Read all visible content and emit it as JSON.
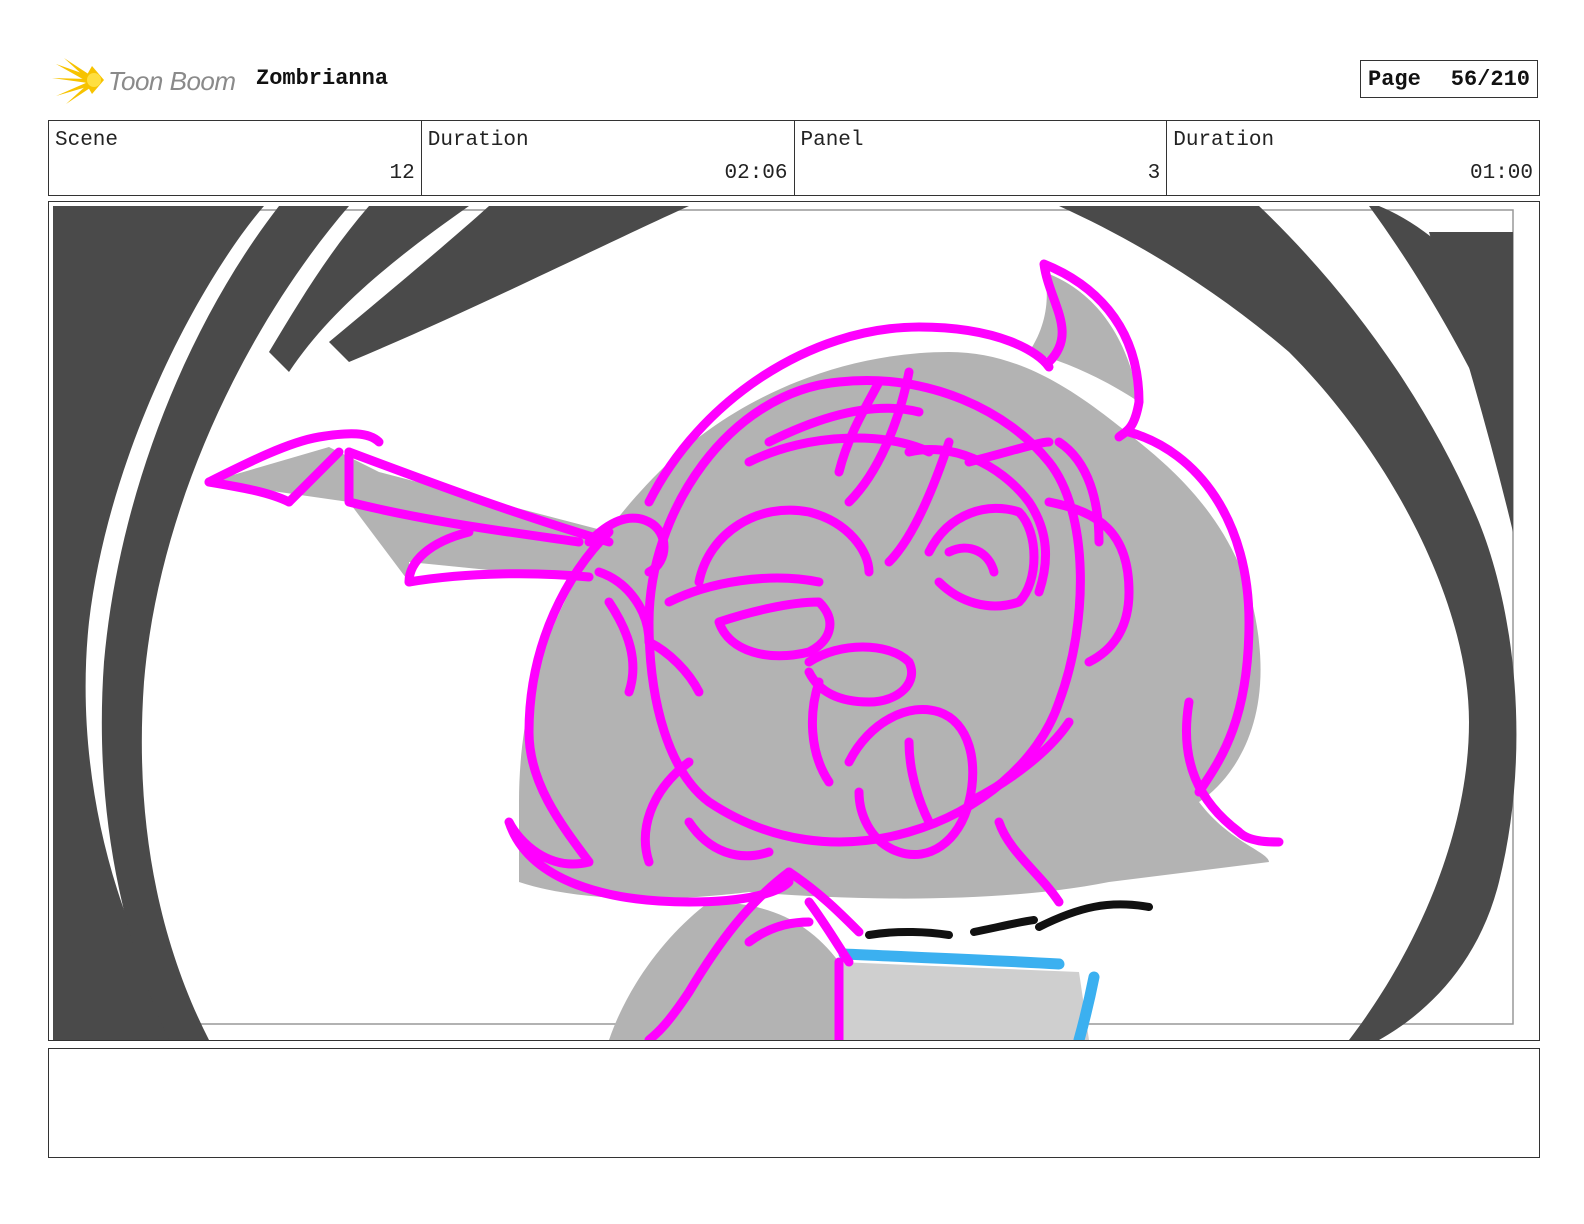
{
  "header": {
    "logo_text": "Toon Boom",
    "project_title": "Zombrianna",
    "page_label": "Page",
    "page_value": "56/210"
  },
  "info": {
    "scene_label": "Scene",
    "scene_value": "12",
    "scene_duration_label": "Duration",
    "scene_duration_value": "02:06",
    "panel_label": "Panel",
    "panel_value": "3",
    "panel_duration_label": "Duration",
    "panel_duration_value": "01:00"
  },
  "colors": {
    "sketch_line": "#ff00ff",
    "fill_gray": "#b3b3b3",
    "vignette": "#4a4a4a",
    "collar_blue": "#3bb0f0",
    "logo_yellow": "#f7c300"
  },
  "notes": {
    "text": ""
  }
}
